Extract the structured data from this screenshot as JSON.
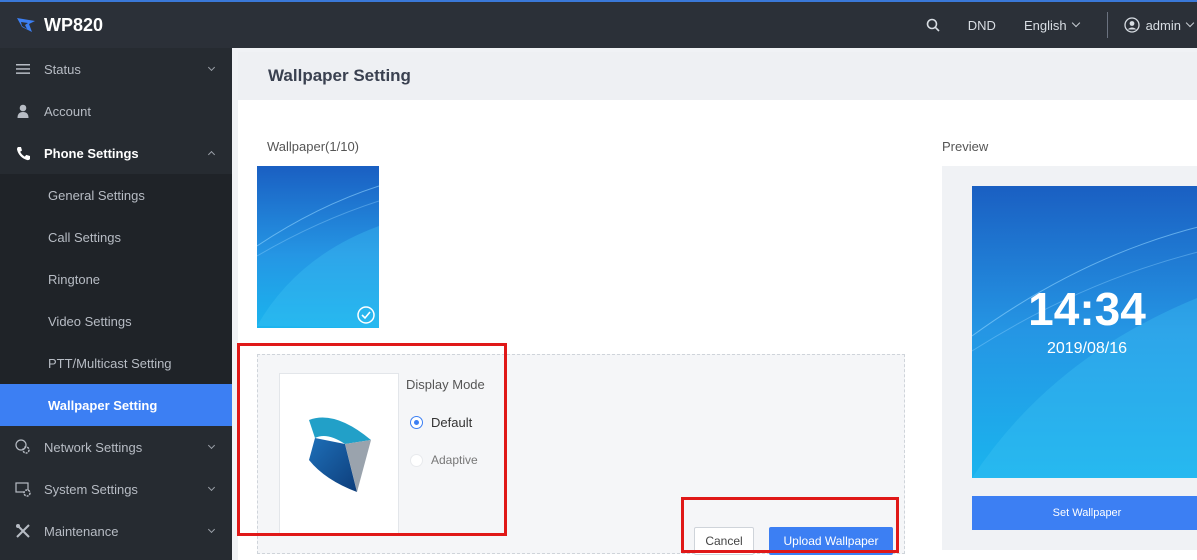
{
  "header": {
    "app_title": "WP820",
    "dnd_label": "DND",
    "language": "English",
    "user": "admin"
  },
  "sidebar": {
    "items": [
      {
        "label": "Status",
        "icon": "list-icon"
      },
      {
        "label": "Account",
        "icon": "user-icon"
      },
      {
        "label": "Phone Settings",
        "icon": "phone-icon"
      },
      {
        "label": "Network Settings",
        "icon": "network-gear-icon"
      },
      {
        "label": "System Settings",
        "icon": "system-gear-icon"
      },
      {
        "label": "Maintenance",
        "icon": "tools-icon"
      }
    ],
    "phone_settings_children": [
      "General Settings",
      "Call Settings",
      "Ringtone",
      "Video Settings",
      "PTT/Multicast Setting",
      "Wallpaper Setting"
    ],
    "active_item": "Wallpaper Setting"
  },
  "main": {
    "page_title": "Wallpaper Setting",
    "wallpaper_label": "Wallpaper(1/10)",
    "preview_label": "Preview",
    "display_mode_label": "Display Mode",
    "display_modes": [
      "Default",
      "Adaptive"
    ],
    "selected_mode": "Default",
    "cancel_label": "Cancel",
    "upload_label": "Upload Wallpaper",
    "set_wallpaper_label": "Set Wallpaper",
    "preview_time": "14:34",
    "preview_date": "2019/08/16"
  },
  "colors": {
    "accent": "#3c7ff3",
    "topbar": "#2b3038",
    "sidebar": "#262b31",
    "highlight": "#e01818"
  }
}
